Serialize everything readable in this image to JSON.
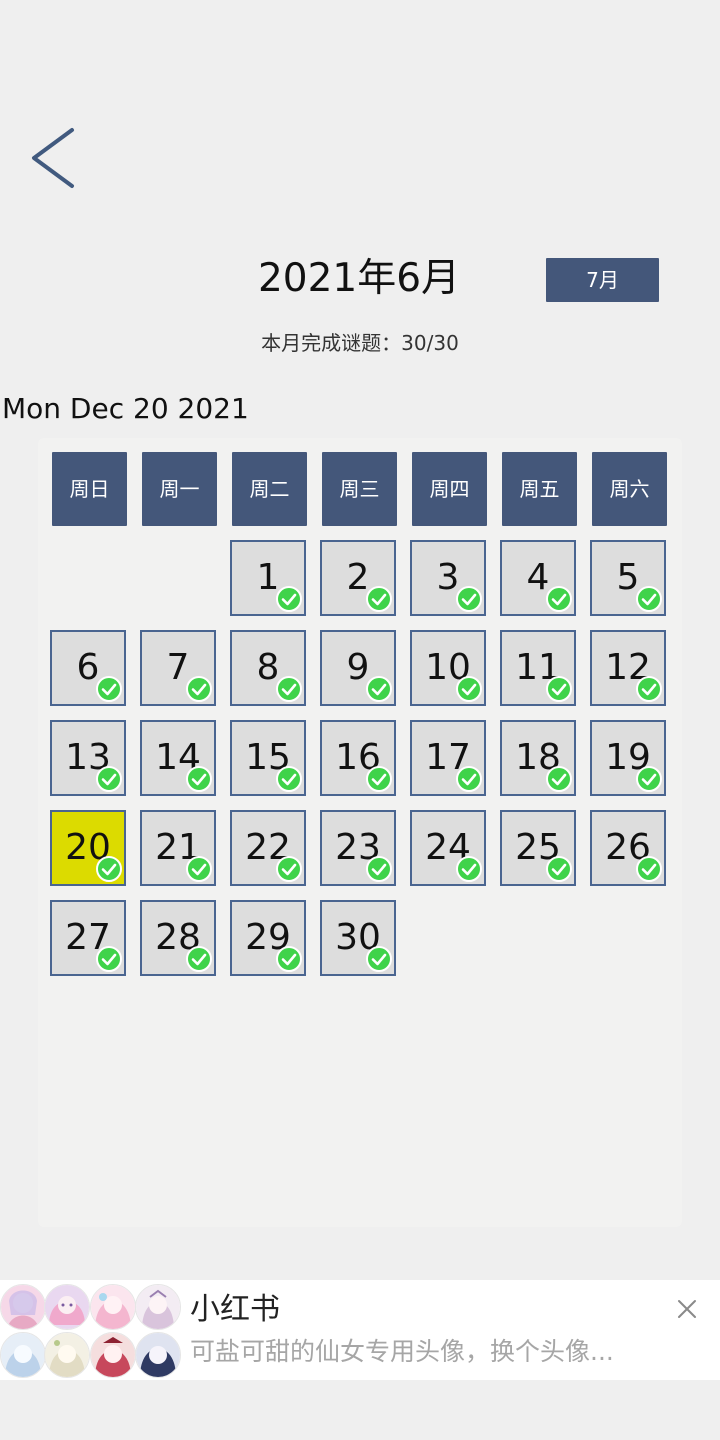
{
  "header": {
    "month_title": "2021年6月",
    "next_month_label": "7月",
    "progress_text": "本月完成谜题：30/30",
    "date_text": "Mon Dec 20 2021"
  },
  "calendar": {
    "weekdays": [
      "周日",
      "周一",
      "周二",
      "周三",
      "周四",
      "周五",
      "周六"
    ],
    "days": [
      "1",
      "2",
      "3",
      "4",
      "5",
      "6",
      "7",
      "8",
      "9",
      "10",
      "11",
      "12",
      "13",
      "14",
      "15",
      "16",
      "17",
      "18",
      "19",
      "20",
      "21",
      "22",
      "23",
      "24",
      "25",
      "26",
      "27",
      "28",
      "29",
      "30"
    ],
    "highlighted_day": "20",
    "completed_icon": "check-circle-icon"
  },
  "ad": {
    "title": "小红书",
    "description": "可盐可甜的仙女专用头像，换个头像..."
  },
  "colors": {
    "accent": "#44577a",
    "today": "#dcdb00",
    "check": "#3fd34a"
  }
}
